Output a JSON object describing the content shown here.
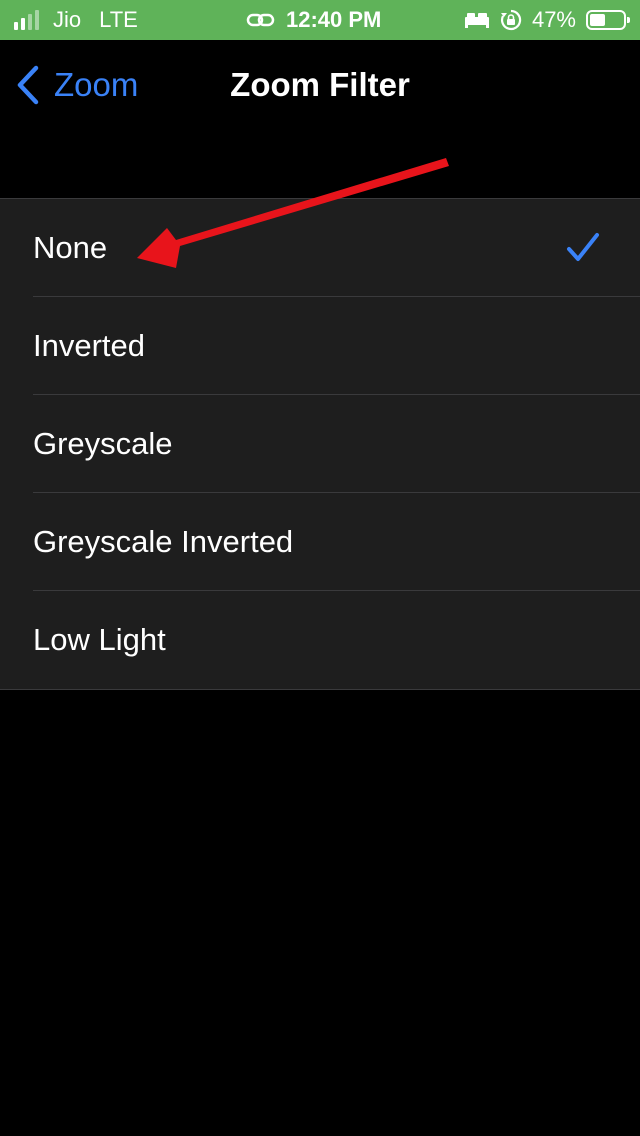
{
  "status_bar": {
    "carrier": "Jio",
    "network": "LTE",
    "time": "12:40 PM",
    "battery_percent": "47%",
    "battery_level": 0.47,
    "background_color": "#5fb359"
  },
  "nav": {
    "back_label": "Zoom",
    "title": "Zoom Filter",
    "accent_color": "#3a82f7"
  },
  "filters": {
    "selected": "None",
    "items": [
      {
        "label": "None",
        "checked": true
      },
      {
        "label": "Inverted",
        "checked": false
      },
      {
        "label": "Greyscale",
        "checked": false
      },
      {
        "label": "Greyscale Inverted",
        "checked": false
      },
      {
        "label": "Low Light",
        "checked": false
      }
    ]
  },
  "icons": {
    "signal": "signal-bars-icon",
    "link": "link-icon",
    "sleep": "bed-icon",
    "rotation_lock": "rotation-lock-icon",
    "battery": "battery-icon",
    "back": "chevron-left-icon",
    "check": "checkmark-icon"
  },
  "annotation": {
    "color": "#e8141b"
  }
}
